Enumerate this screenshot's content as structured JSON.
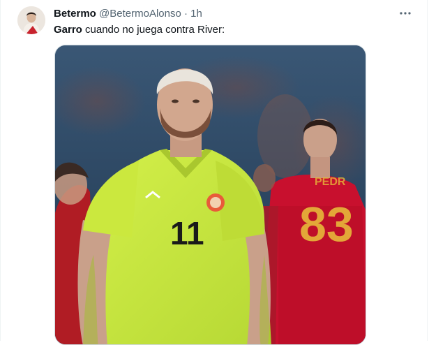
{
  "tweet": {
    "author_name": "Betermo",
    "author_handle": "@BetermoAlonso",
    "separator": "·",
    "time": "1h",
    "text_bold": "Garro",
    "text_rest": " cuando no juega contra River:",
    "more_icon": "more-horizontal-icon"
  },
  "media": {
    "description_icon": "photo",
    "jersey_number": "11",
    "colors": {
      "keeper_shirt": "#c8ea3c",
      "spain_red": "#c8102e",
      "spain_number": "#e8b83a",
      "background": "#2c4a6a"
    }
  }
}
